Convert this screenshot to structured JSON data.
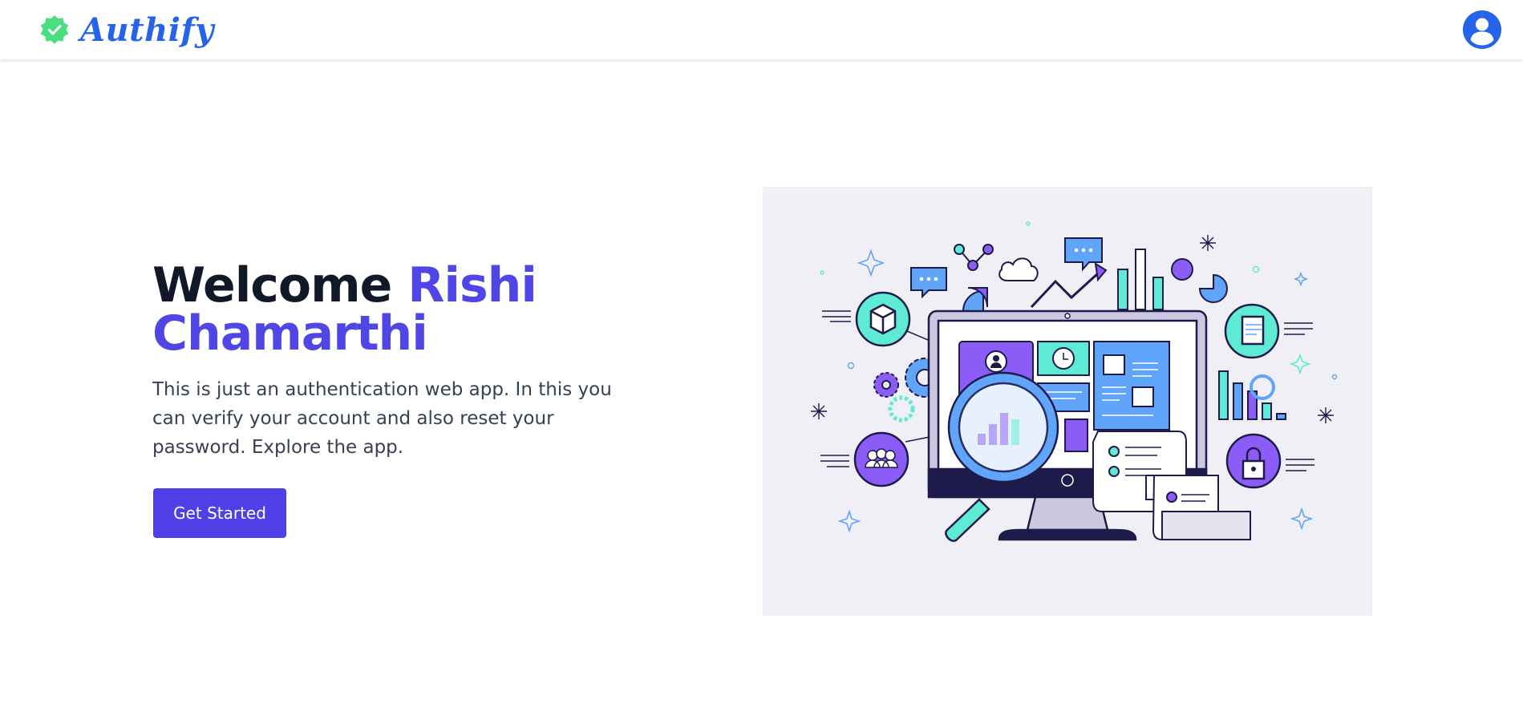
{
  "brand": {
    "name": "Authify",
    "logo_icon": "verified-badge-icon",
    "logo_color": "#4ade80"
  },
  "header": {
    "avatar_icon": "user-circle-icon",
    "accent": "#2563eb"
  },
  "hero": {
    "greeting": "Welcome",
    "user_name": "Rishi Chamarthi",
    "description": "This is just an authentication web app. In this you can verify your account and also reset your password. Explore the app.",
    "cta_label": "Get Started",
    "accent": "#4f46e5"
  },
  "illustration": {
    "subject": "data-analytics-dashboard-illustration",
    "background": "#f0eff5"
  }
}
